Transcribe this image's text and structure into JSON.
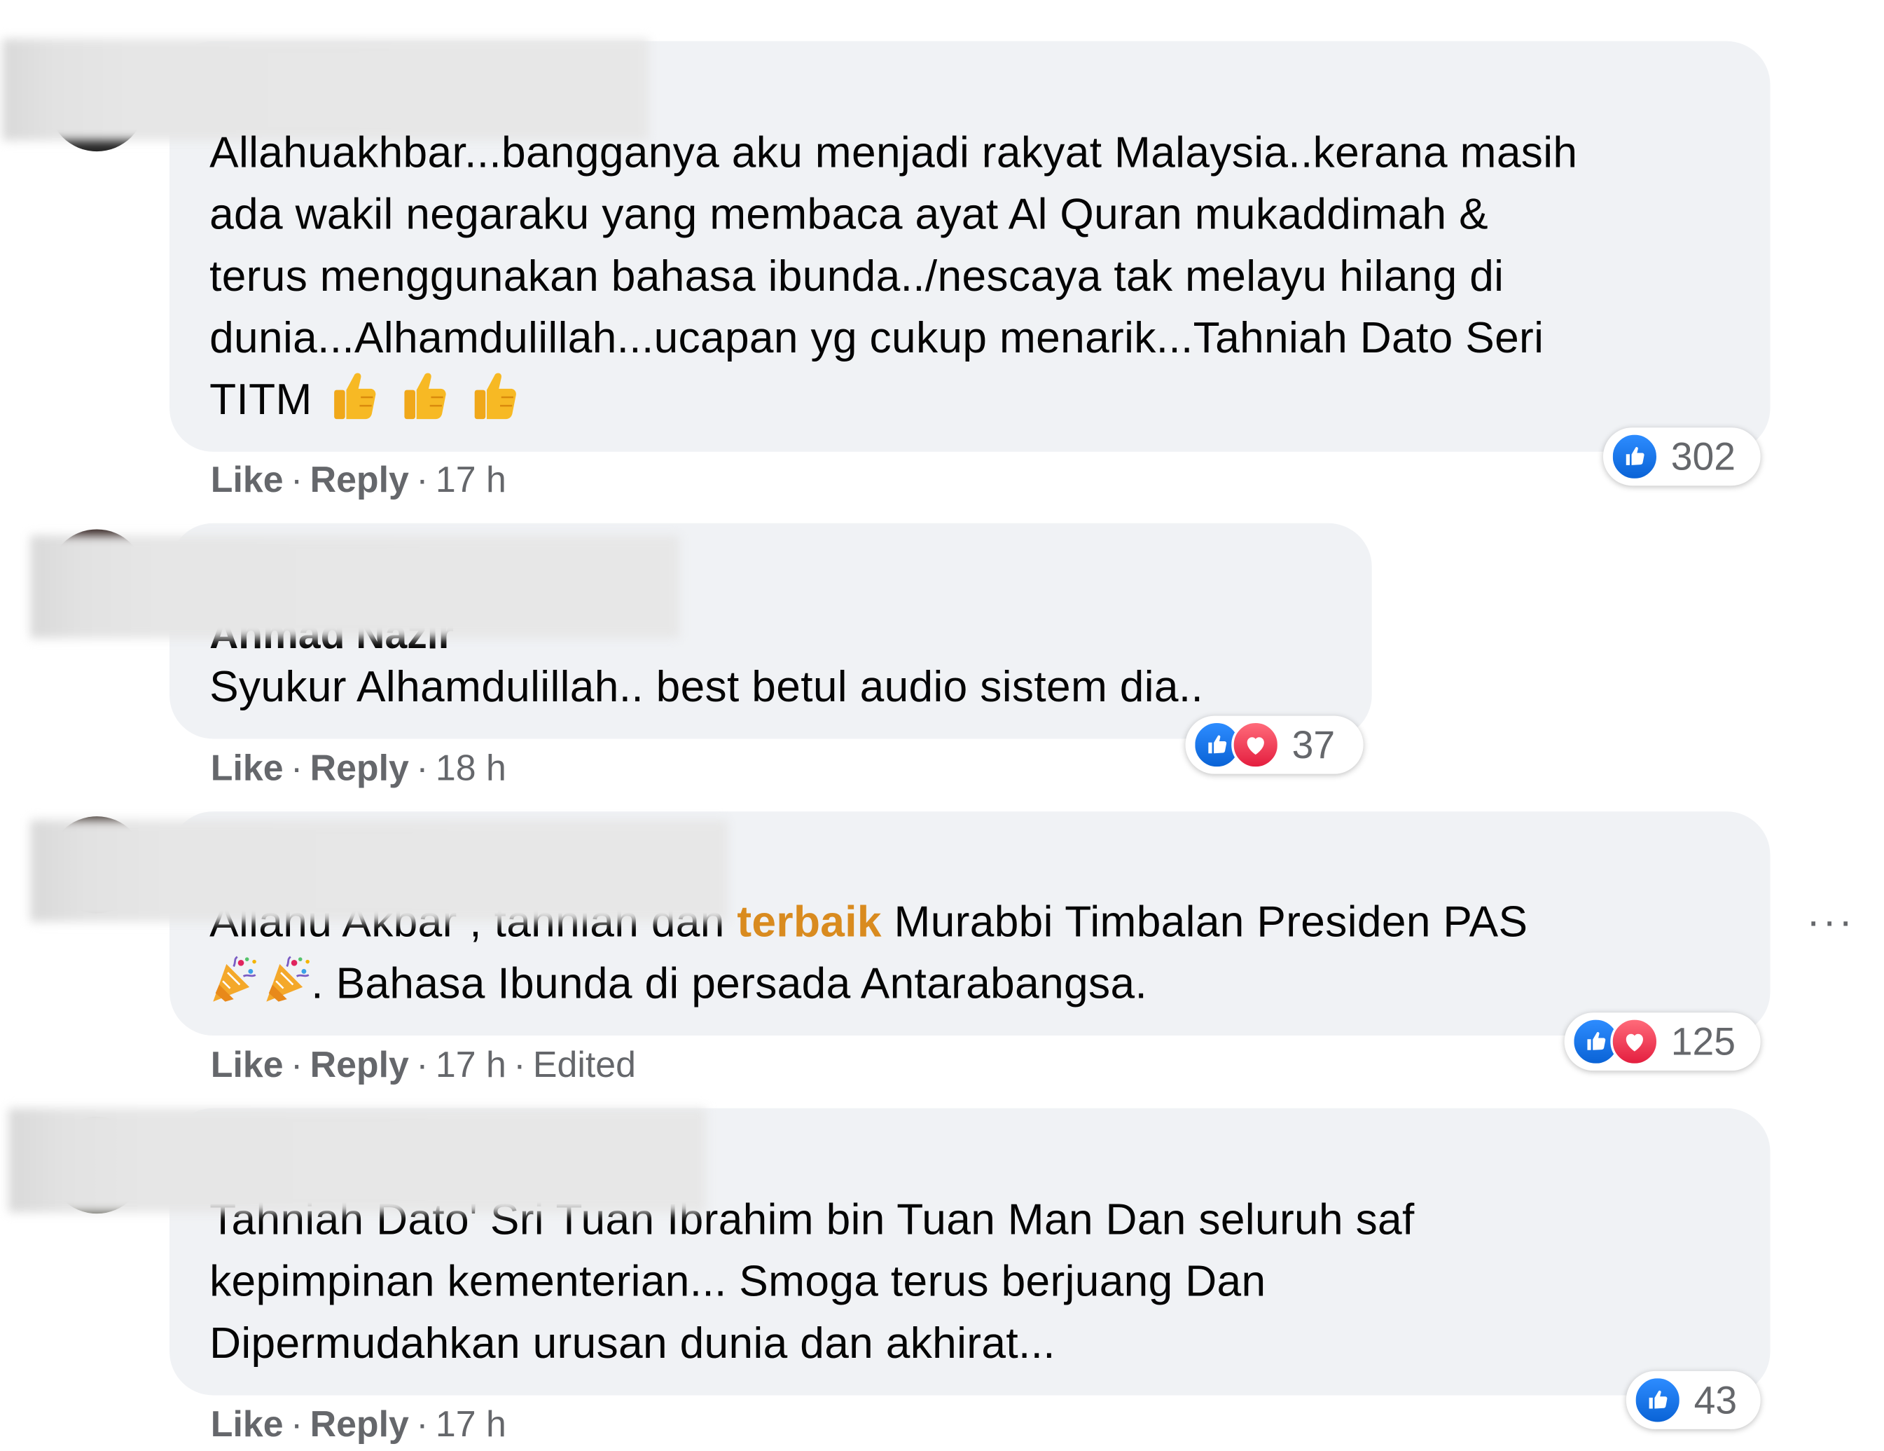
{
  "comments": [
    {
      "author_partial": "",
      "lines": [
        "Allahuakhbar...bangganya aku menjadi rakyat Malaysia..kerana masih",
        "ada wakil negaraku yang membaca ayat Al Quran mukaddimah &",
        "terus menggunakan bahasa ibunda../nescaya tak melayu hilang di",
        "dunia...Alhamdulillah...ucapan yg cukup menarik...Tahniah Dato Seri",
        "TITM"
      ],
      "emojis": [
        "thumbs-up-emoji",
        "thumbs-up-emoji",
        "thumbs-up-emoji"
      ],
      "like_label": "Like",
      "reply_label": "Reply",
      "time": "17 h",
      "reactions": [
        "like"
      ],
      "reaction_count": "302"
    },
    {
      "author_partial": "Ahmad Nazir",
      "lines": [
        "Syukur Alhamdulillah.. best betul audio sistem dia.."
      ],
      "like_label": "Like",
      "reply_label": "Reply",
      "time": "18 h",
      "reactions": [
        "like",
        "love"
      ],
      "reaction_count": "37"
    },
    {
      "author_partial": "",
      "line1_pre": "Allahu Akbar , tahniah dan",
      "mention": "terbaik",
      "line1_post": "Murabbi Timbalan Presiden PAS",
      "line2": ". Bahasa Ibunda di persada Antarabangsa.",
      "emojis": [
        "party-popper-emoji",
        "party-popper-emoji"
      ],
      "like_label": "Like",
      "reply_label": "Reply",
      "time": "17 h",
      "edited_label": "Edited",
      "reactions": [
        "like",
        "love"
      ],
      "reaction_count": "125",
      "more_label": "···"
    },
    {
      "author_partial": "",
      "lines": [
        "Tahniah Dato' Sri Tuan Ibrahim bin Tuan Man Dan seluruh saf",
        "kepimpinan kementerian... Smoga terus berjuang Dan",
        "Dipermudahkan urusan dunia dan akhirat..."
      ],
      "like_label": "Like",
      "reply_label": "Reply",
      "time": "17 h",
      "reactions": [
        "like"
      ],
      "reaction_count": "43"
    }
  ],
  "colors": {
    "bubble": "#f0f2f5",
    "text": "#050505",
    "meta": "#65676b",
    "like": "#1877f2",
    "love": "#f33e58",
    "mention": "#d98b1f"
  }
}
